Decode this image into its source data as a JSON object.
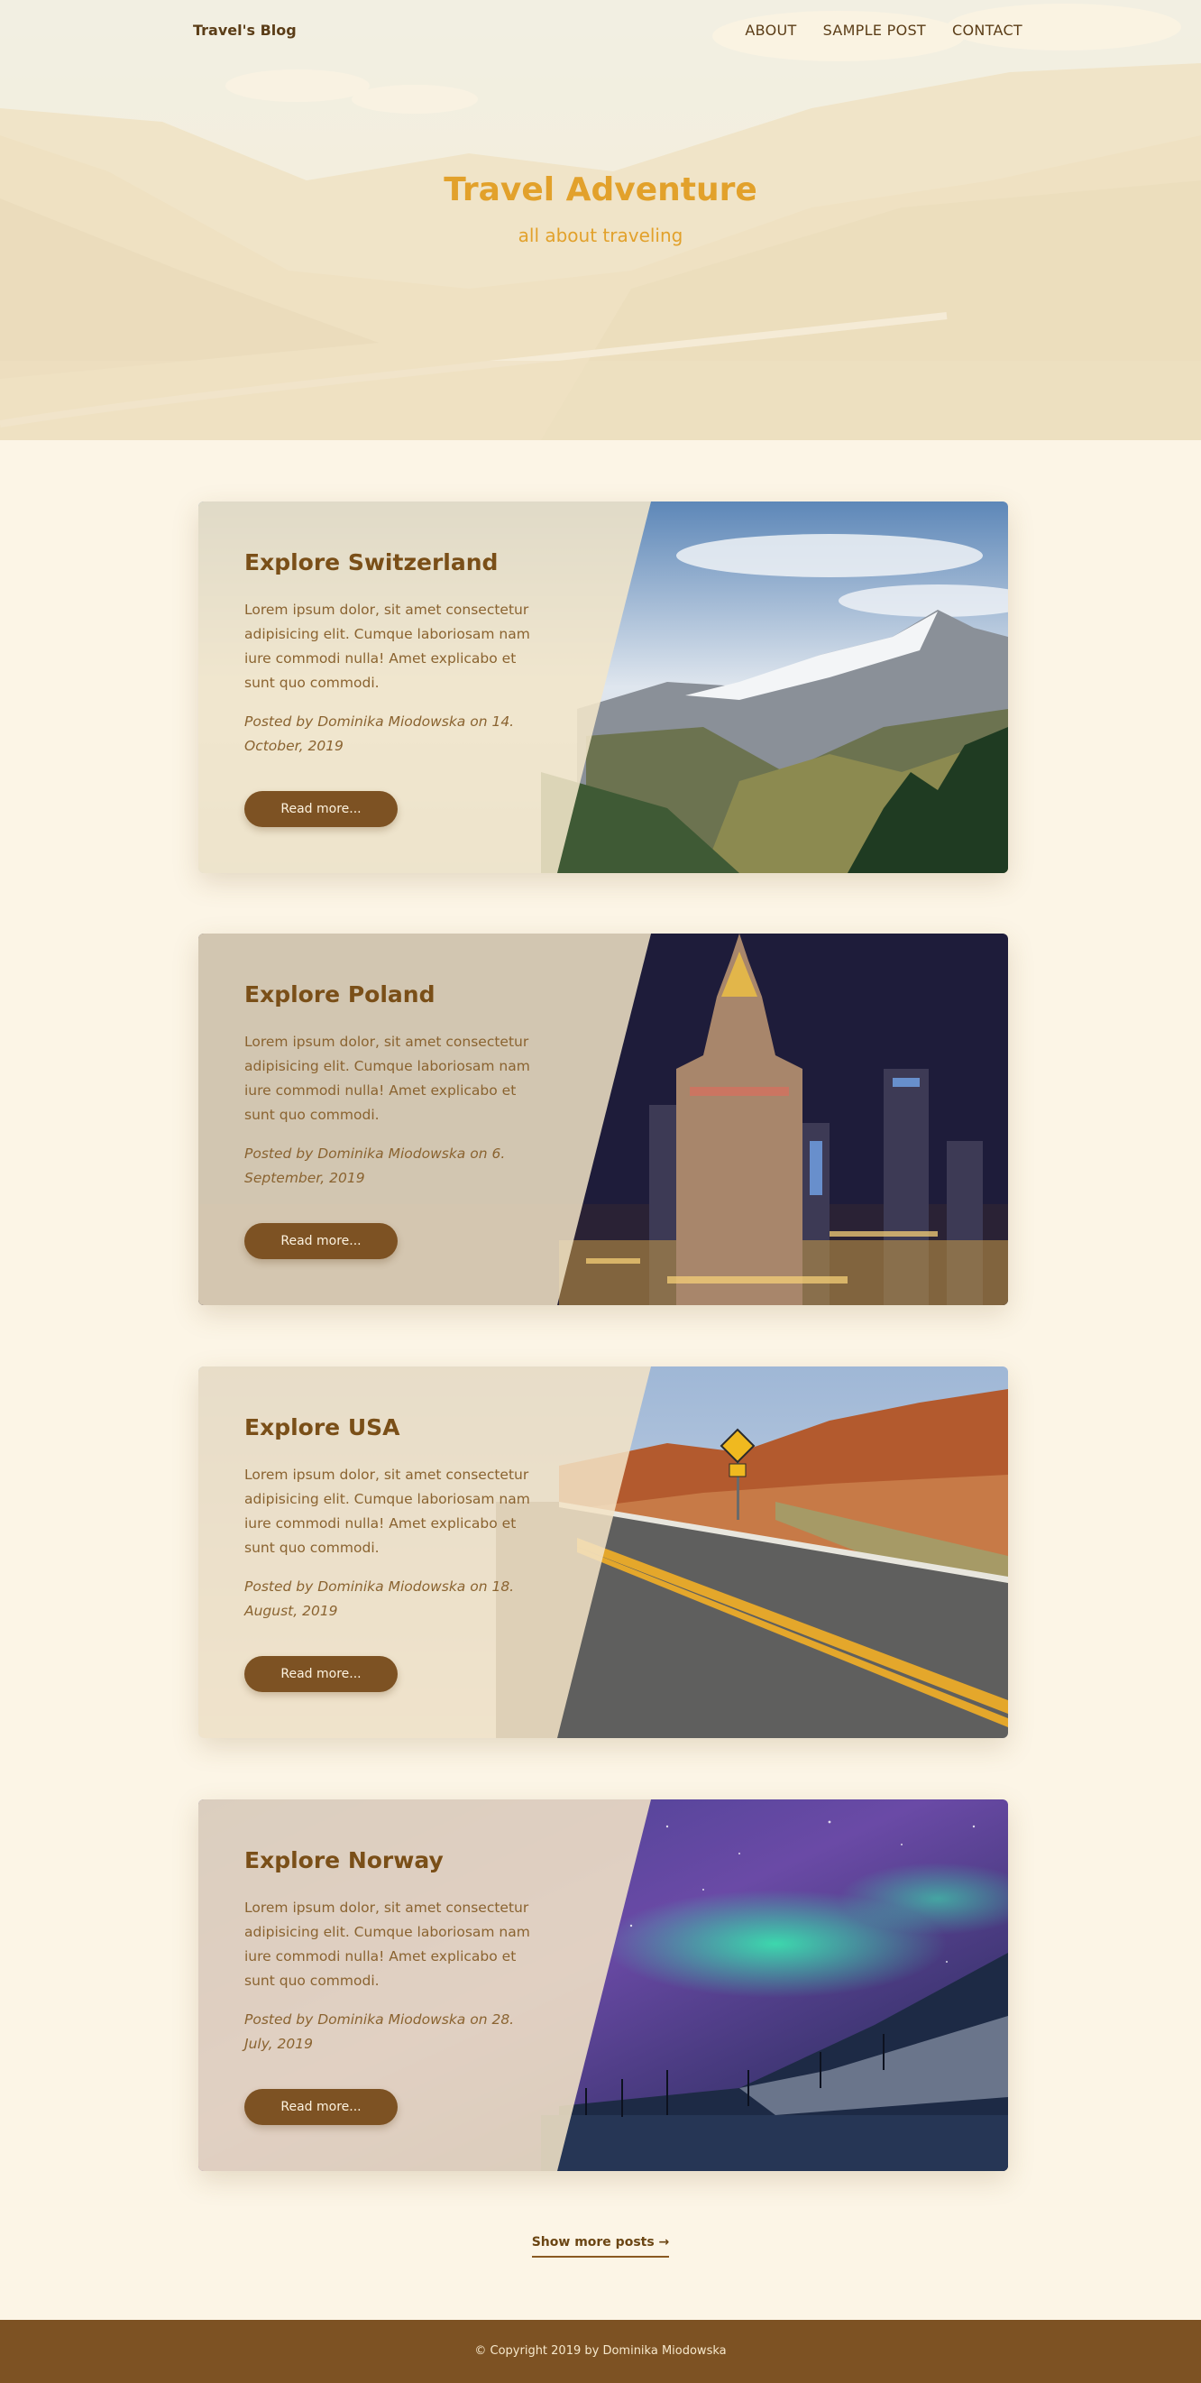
{
  "nav": {
    "brand": "Travel's Blog",
    "links": [
      "ABOUT",
      "SAMPLE POST",
      "CONTACT"
    ]
  },
  "hero": {
    "title": "Travel Adventure",
    "subtitle": "all about traveling"
  },
  "posts": [
    {
      "title": "Explore Switzerland",
      "excerpt": "Lorem ipsum dolor, sit amet consectetur adipisicing elit. Cumque laboriosam nam iure commodi nulla! Amet explicabo et sunt quo commodi.",
      "meta": "Posted by Dominika Miodowska on 14. October, 2019",
      "button": "Read more..."
    },
    {
      "title": "Explore Poland",
      "excerpt": "Lorem ipsum dolor, sit amet consectetur adipisicing elit. Cumque laboriosam nam iure commodi nulla! Amet explicabo et sunt quo commodi.",
      "meta": "Posted by Dominika Miodowska on 6. September, 2019",
      "button": "Read more..."
    },
    {
      "title": "Explore USA",
      "excerpt": "Lorem ipsum dolor, sit amet consectetur adipisicing elit. Cumque laboriosam nam iure commodi nulla! Amet explicabo et sunt quo commodi.",
      "meta": "Posted by Dominika Miodowska on 18. August, 2019",
      "button": "Read more..."
    },
    {
      "title": "Explore Norway",
      "excerpt": "Lorem ipsum dolor, sit amet consectetur adipisicing elit. Cumque laboriosam nam iure commodi nulla! Amet explicabo et sunt quo commodi.",
      "meta": "Posted by Dominika Miodowska on 28. July, 2019",
      "button": "Read more..."
    }
  ],
  "more_link": "Show more posts →",
  "footer": "© Copyright 2019 by Dominika Miodowska",
  "colors": {
    "background": "#fcf5e6",
    "accent": "#e2a12b",
    "brown": "#7d5223"
  }
}
